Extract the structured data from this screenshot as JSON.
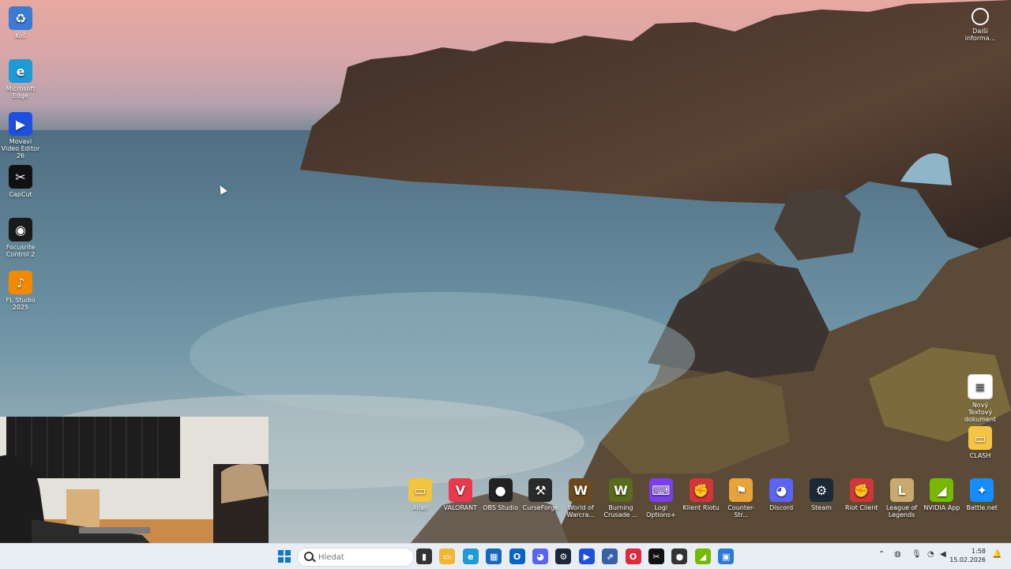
{
  "desktop_left_icons": [
    {
      "id": "recycle",
      "label": "Koš",
      "color": "#3a7bd5",
      "glyph": "♻"
    },
    {
      "id": "edge",
      "label": "Microsoft Edge",
      "color": "#1e9ad6",
      "glyph": "e"
    },
    {
      "id": "movavi",
      "label": "Movavi Video Editor 26",
      "color": "#1d4fe0",
      "glyph": "▶"
    },
    {
      "id": "capcut",
      "label": "CapCut",
      "color": "#111111",
      "glyph": "✂"
    },
    {
      "id": "focusrite",
      "label": "Focusrite Control 2",
      "color": "#1a1a1a",
      "glyph": "◉"
    },
    {
      "id": "flstudio",
      "label": "FL Studio 2025",
      "color": "#f28a00",
      "glyph": "♪"
    }
  ],
  "desktop_bottom_icons": [
    {
      "id": "allan",
      "label": "Allan",
      "color": "#f2c53d",
      "glyph": "▭"
    },
    {
      "id": "valorant",
      "label": "VALORANT",
      "color": "#e8394d",
      "glyph": "V"
    },
    {
      "id": "obs",
      "label": "OBS Studio",
      "color": "#222222",
      "glyph": "●"
    },
    {
      "id": "curseforge",
      "label": "CurseForge",
      "color": "#2a2a2a",
      "glyph": "⚒"
    },
    {
      "id": "wow",
      "label": "World of Warcra...",
      "color": "#6b4a1d",
      "glyph": "W"
    },
    {
      "id": "burning",
      "label": "Burning Crusade ...",
      "color": "#5a6b1d",
      "glyph": "W"
    },
    {
      "id": "logi",
      "label": "Logi Options+",
      "color": "#7b3ff2",
      "glyph": "⌨"
    },
    {
      "id": "riotclientu",
      "label": "Klient Riotu",
      "color": "#d13639",
      "glyph": "✊"
    },
    {
      "id": "counterstrike",
      "label": "Counter-Str...",
      "color": "#e8a33b",
      "glyph": "⚑"
    },
    {
      "id": "discord",
      "label": "Discord",
      "color": "#5865f2",
      "glyph": "◕"
    },
    {
      "id": "steam",
      "label": "Steam",
      "color": "#1b2838",
      "glyph": "⚙"
    },
    {
      "id": "riotclient",
      "label": "Riot Client",
      "color": "#d13639",
      "glyph": "✊"
    },
    {
      "id": "lol",
      "label": "League of Legends",
      "color": "#c8aa6e",
      "glyph": "L"
    },
    {
      "id": "nvidia",
      "label": "NVIDIA App",
      "color": "#76b900",
      "glyph": "◢"
    },
    {
      "id": "battlenet",
      "label": "Battle.net",
      "color": "#148eff",
      "glyph": "✦"
    }
  ],
  "desktop_right_icons": [
    {
      "id": "textdoc",
      "label": "Nový Textový dokument",
      "color": "#ffffff",
      "glyph": "≡"
    },
    {
      "id": "clash",
      "label": "CLASH",
      "color": "#f5c542",
      "glyph": "▭"
    }
  ],
  "more_info": {
    "label": "Další informa..."
  },
  "taskbar": {
    "search_placeholder": "Hledat",
    "pinned": [
      {
        "id": "taskview",
        "color": "#333333",
        "glyph": "▮"
      },
      {
        "id": "explorer",
        "color": "#f2b632",
        "glyph": "▭"
      },
      {
        "id": "edge",
        "color": "#1e9ad6",
        "glyph": "e"
      },
      {
        "id": "store",
        "color": "#1566c0",
        "glyph": "▦"
      },
      {
        "id": "outlook",
        "color": "#0a64c8",
        "glyph": "O"
      },
      {
        "id": "discord",
        "color": "#5865f2",
        "glyph": "◕"
      },
      {
        "id": "steam",
        "color": "#1b2838",
        "glyph": "⚙"
      },
      {
        "id": "movavi",
        "color": "#1d4fe0",
        "glyph": "▶"
      },
      {
        "id": "app-blue",
        "color": "#3a5ea8",
        "glyph": "⇗"
      },
      {
        "id": "opera",
        "color": "#e02a3a",
        "glyph": "O"
      },
      {
        "id": "capcut",
        "color": "#111111",
        "glyph": "✂"
      },
      {
        "id": "obs",
        "color": "#333333",
        "glyph": "●"
      },
      {
        "id": "nvidia",
        "color": "#76b900",
        "glyph": "◢"
      },
      {
        "id": "photos",
        "color": "#2b7bd6",
        "glyph": "▣"
      }
    ],
    "clock_time": "1:58",
    "clock_date": "15.02.2026"
  }
}
